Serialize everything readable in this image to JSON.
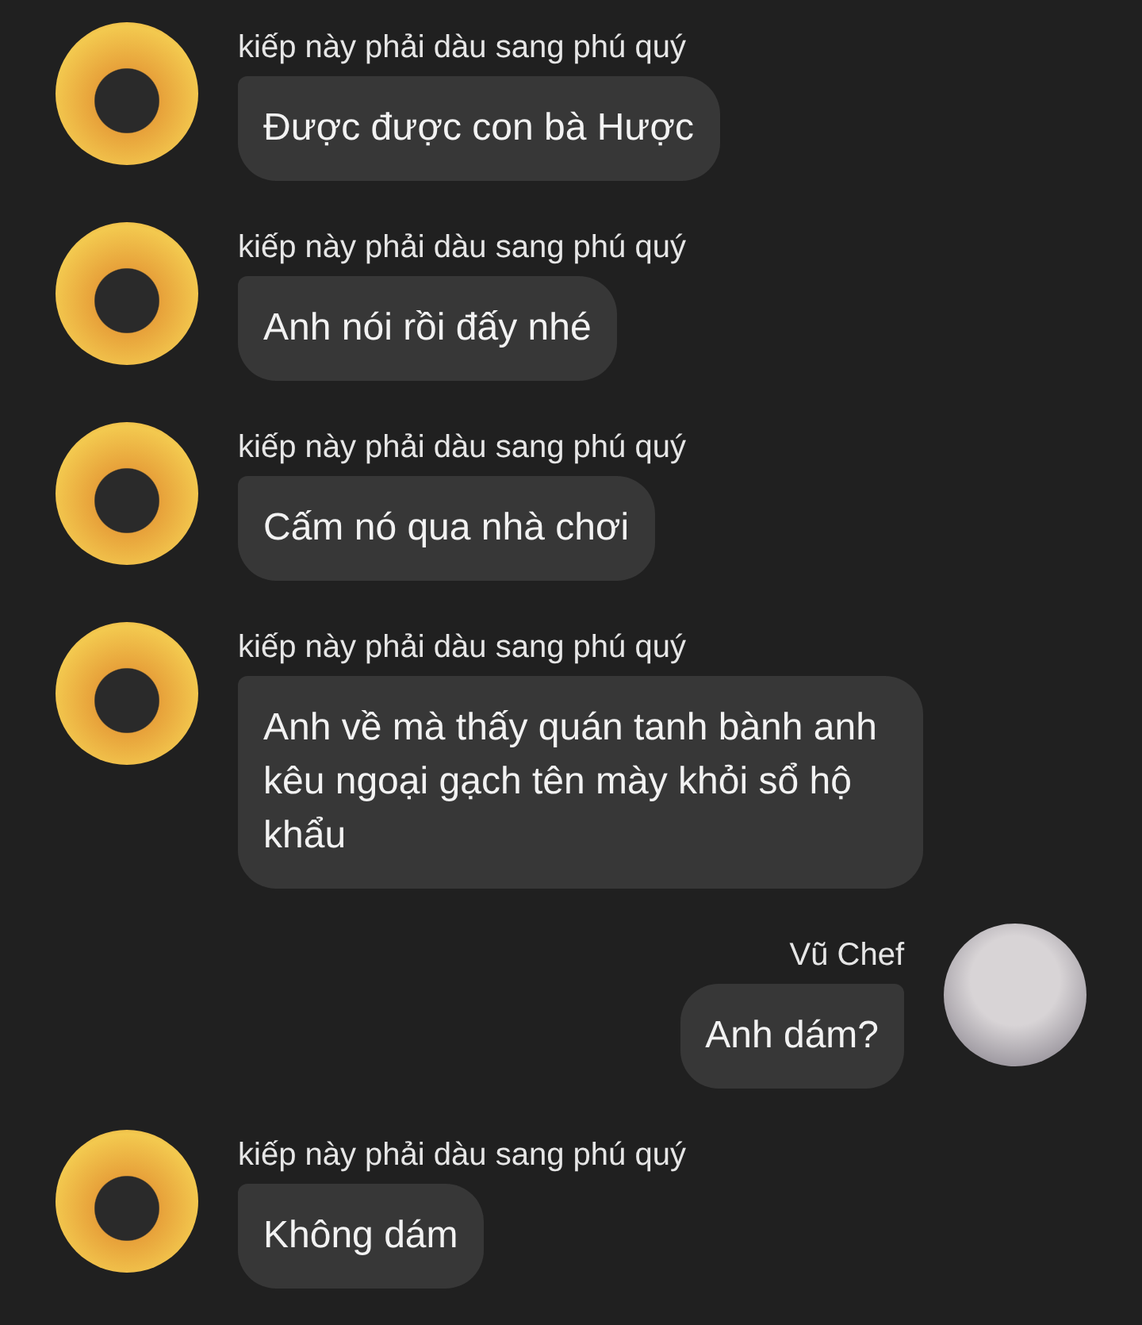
{
  "messages": [
    {
      "kind": "incoming",
      "sender": "kiếp này phải dàu sang phú quý",
      "text": "Được được con bà Hược"
    },
    {
      "kind": "incoming",
      "sender": "kiếp này phải dàu sang phú quý",
      "text": "Anh nói rồi đấy nhé"
    },
    {
      "kind": "incoming",
      "sender": "kiếp này phải dàu sang phú quý",
      "text": "Cấm nó qua nhà chơi"
    },
    {
      "kind": "incoming",
      "sender": "kiếp này phải dàu sang phú quý",
      "text": "Anh về mà thấy quán tanh bành anh kêu ngoại gạch tên mày khỏi sổ hộ khẩu"
    },
    {
      "kind": "outgoing",
      "sender": "Vũ Chef",
      "text": "Anh dám?"
    },
    {
      "kind": "incoming",
      "sender": "kiếp này phải dàu sang phú quý",
      "text": "Không dám"
    }
  ]
}
